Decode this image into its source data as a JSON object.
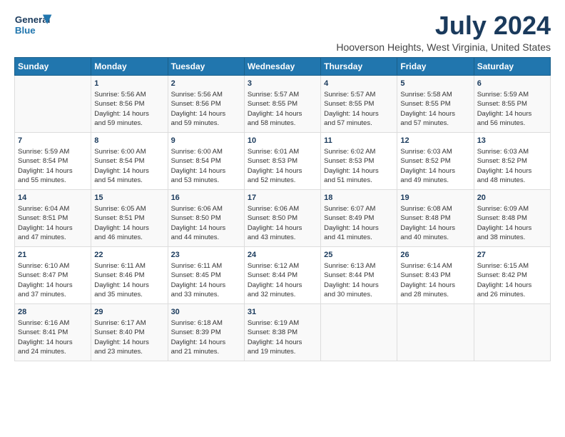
{
  "header": {
    "logo_line1": "General",
    "logo_line2": "Blue",
    "title": "July 2024",
    "subtitle": "Hooverson Heights, West Virginia, United States"
  },
  "days_of_week": [
    "Sunday",
    "Monday",
    "Tuesday",
    "Wednesday",
    "Thursday",
    "Friday",
    "Saturday"
  ],
  "weeks": [
    [
      {
        "day": "",
        "content": ""
      },
      {
        "day": "1",
        "content": "Sunrise: 5:56 AM\nSunset: 8:56 PM\nDaylight: 14 hours\nand 59 minutes."
      },
      {
        "day": "2",
        "content": "Sunrise: 5:56 AM\nSunset: 8:56 PM\nDaylight: 14 hours\nand 59 minutes."
      },
      {
        "day": "3",
        "content": "Sunrise: 5:57 AM\nSunset: 8:55 PM\nDaylight: 14 hours\nand 58 minutes."
      },
      {
        "day": "4",
        "content": "Sunrise: 5:57 AM\nSunset: 8:55 PM\nDaylight: 14 hours\nand 57 minutes."
      },
      {
        "day": "5",
        "content": "Sunrise: 5:58 AM\nSunset: 8:55 PM\nDaylight: 14 hours\nand 57 minutes."
      },
      {
        "day": "6",
        "content": "Sunrise: 5:59 AM\nSunset: 8:55 PM\nDaylight: 14 hours\nand 56 minutes."
      }
    ],
    [
      {
        "day": "7",
        "content": "Sunrise: 5:59 AM\nSunset: 8:54 PM\nDaylight: 14 hours\nand 55 minutes."
      },
      {
        "day": "8",
        "content": "Sunrise: 6:00 AM\nSunset: 8:54 PM\nDaylight: 14 hours\nand 54 minutes."
      },
      {
        "day": "9",
        "content": "Sunrise: 6:00 AM\nSunset: 8:54 PM\nDaylight: 14 hours\nand 53 minutes."
      },
      {
        "day": "10",
        "content": "Sunrise: 6:01 AM\nSunset: 8:53 PM\nDaylight: 14 hours\nand 52 minutes."
      },
      {
        "day": "11",
        "content": "Sunrise: 6:02 AM\nSunset: 8:53 PM\nDaylight: 14 hours\nand 51 minutes."
      },
      {
        "day": "12",
        "content": "Sunrise: 6:03 AM\nSunset: 8:52 PM\nDaylight: 14 hours\nand 49 minutes."
      },
      {
        "day": "13",
        "content": "Sunrise: 6:03 AM\nSunset: 8:52 PM\nDaylight: 14 hours\nand 48 minutes."
      }
    ],
    [
      {
        "day": "14",
        "content": "Sunrise: 6:04 AM\nSunset: 8:51 PM\nDaylight: 14 hours\nand 47 minutes."
      },
      {
        "day": "15",
        "content": "Sunrise: 6:05 AM\nSunset: 8:51 PM\nDaylight: 14 hours\nand 46 minutes."
      },
      {
        "day": "16",
        "content": "Sunrise: 6:06 AM\nSunset: 8:50 PM\nDaylight: 14 hours\nand 44 minutes."
      },
      {
        "day": "17",
        "content": "Sunrise: 6:06 AM\nSunset: 8:50 PM\nDaylight: 14 hours\nand 43 minutes."
      },
      {
        "day": "18",
        "content": "Sunrise: 6:07 AM\nSunset: 8:49 PM\nDaylight: 14 hours\nand 41 minutes."
      },
      {
        "day": "19",
        "content": "Sunrise: 6:08 AM\nSunset: 8:48 PM\nDaylight: 14 hours\nand 40 minutes."
      },
      {
        "day": "20",
        "content": "Sunrise: 6:09 AM\nSunset: 8:48 PM\nDaylight: 14 hours\nand 38 minutes."
      }
    ],
    [
      {
        "day": "21",
        "content": "Sunrise: 6:10 AM\nSunset: 8:47 PM\nDaylight: 14 hours\nand 37 minutes."
      },
      {
        "day": "22",
        "content": "Sunrise: 6:11 AM\nSunset: 8:46 PM\nDaylight: 14 hours\nand 35 minutes."
      },
      {
        "day": "23",
        "content": "Sunrise: 6:11 AM\nSunset: 8:45 PM\nDaylight: 14 hours\nand 33 minutes."
      },
      {
        "day": "24",
        "content": "Sunrise: 6:12 AM\nSunset: 8:44 PM\nDaylight: 14 hours\nand 32 minutes."
      },
      {
        "day": "25",
        "content": "Sunrise: 6:13 AM\nSunset: 8:44 PM\nDaylight: 14 hours\nand 30 minutes."
      },
      {
        "day": "26",
        "content": "Sunrise: 6:14 AM\nSunset: 8:43 PM\nDaylight: 14 hours\nand 28 minutes."
      },
      {
        "day": "27",
        "content": "Sunrise: 6:15 AM\nSunset: 8:42 PM\nDaylight: 14 hours\nand 26 minutes."
      }
    ],
    [
      {
        "day": "28",
        "content": "Sunrise: 6:16 AM\nSunset: 8:41 PM\nDaylight: 14 hours\nand 24 minutes."
      },
      {
        "day": "29",
        "content": "Sunrise: 6:17 AM\nSunset: 8:40 PM\nDaylight: 14 hours\nand 23 minutes."
      },
      {
        "day": "30",
        "content": "Sunrise: 6:18 AM\nSunset: 8:39 PM\nDaylight: 14 hours\nand 21 minutes."
      },
      {
        "day": "31",
        "content": "Sunrise: 6:19 AM\nSunset: 8:38 PM\nDaylight: 14 hours\nand 19 minutes."
      },
      {
        "day": "",
        "content": ""
      },
      {
        "day": "",
        "content": ""
      },
      {
        "day": "",
        "content": ""
      }
    ]
  ]
}
